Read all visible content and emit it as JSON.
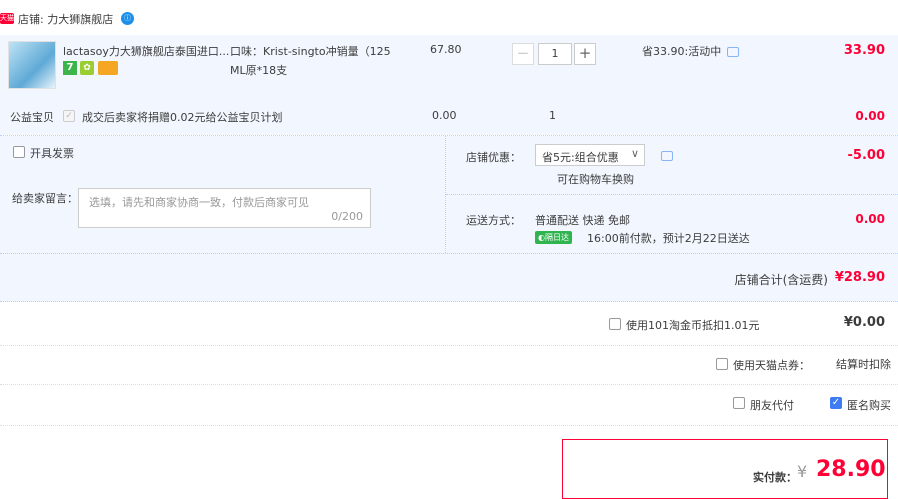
{
  "shop": {
    "tag": "天猫",
    "label": "店铺: 力大狮旗舰店"
  },
  "item": {
    "title": "lactasoy力大狮旗舰店泰国进口...",
    "sku_line1": "口味：Krist-singto冲销量（125",
    "sku_line2": "ML原*18支",
    "price": "67.80",
    "quantity": "1",
    "minus": "−",
    "plus": "+",
    "promo": "省33.90:活动中",
    "subtotal": "33.90",
    "badge_7": "7"
  },
  "charity": {
    "name": "公益宝贝",
    "desc": "成交后卖家将捐赠0.02元给公益宝贝计划",
    "price": "0.00",
    "qty": "1",
    "subtotal": "0.00"
  },
  "invoice": {
    "label": "开具发票"
  },
  "message": {
    "label": "给卖家留言：",
    "placeholder": "选填，请先和商家协商一致，付款后商家可见",
    "counter": "0/200"
  },
  "coupon": {
    "label": "店铺优惠：",
    "selected": "省5元:组合优惠",
    "hint": "可在购物车换购",
    "amount": "-5.00"
  },
  "shipping": {
    "label": "运送方式：",
    "method": "普通配送 快递 免邮",
    "badge": "隔日达",
    "eta": "16:00前付款，预计2月22日送达",
    "amount": "0.00"
  },
  "shop_total": {
    "label": "店铺合计(含运费)",
    "value": "¥28.90"
  },
  "taobao_coin": {
    "label": "使用101淘金币抵扣1.01元",
    "value": "¥0.00"
  },
  "tmall_points": {
    "label": "使用天猫点券：",
    "value": "结算时扣除"
  },
  "options": {
    "friend_pay": "朋友代付",
    "anonymous": "匿名购买"
  },
  "payment": {
    "label": "实付款：",
    "currency": "¥",
    "amount": "28.90"
  },
  "colors": {
    "accent_red": "#ff0036",
    "light_blue_bg": "#f2f7ff",
    "check_blue": "#3d7cf2"
  }
}
